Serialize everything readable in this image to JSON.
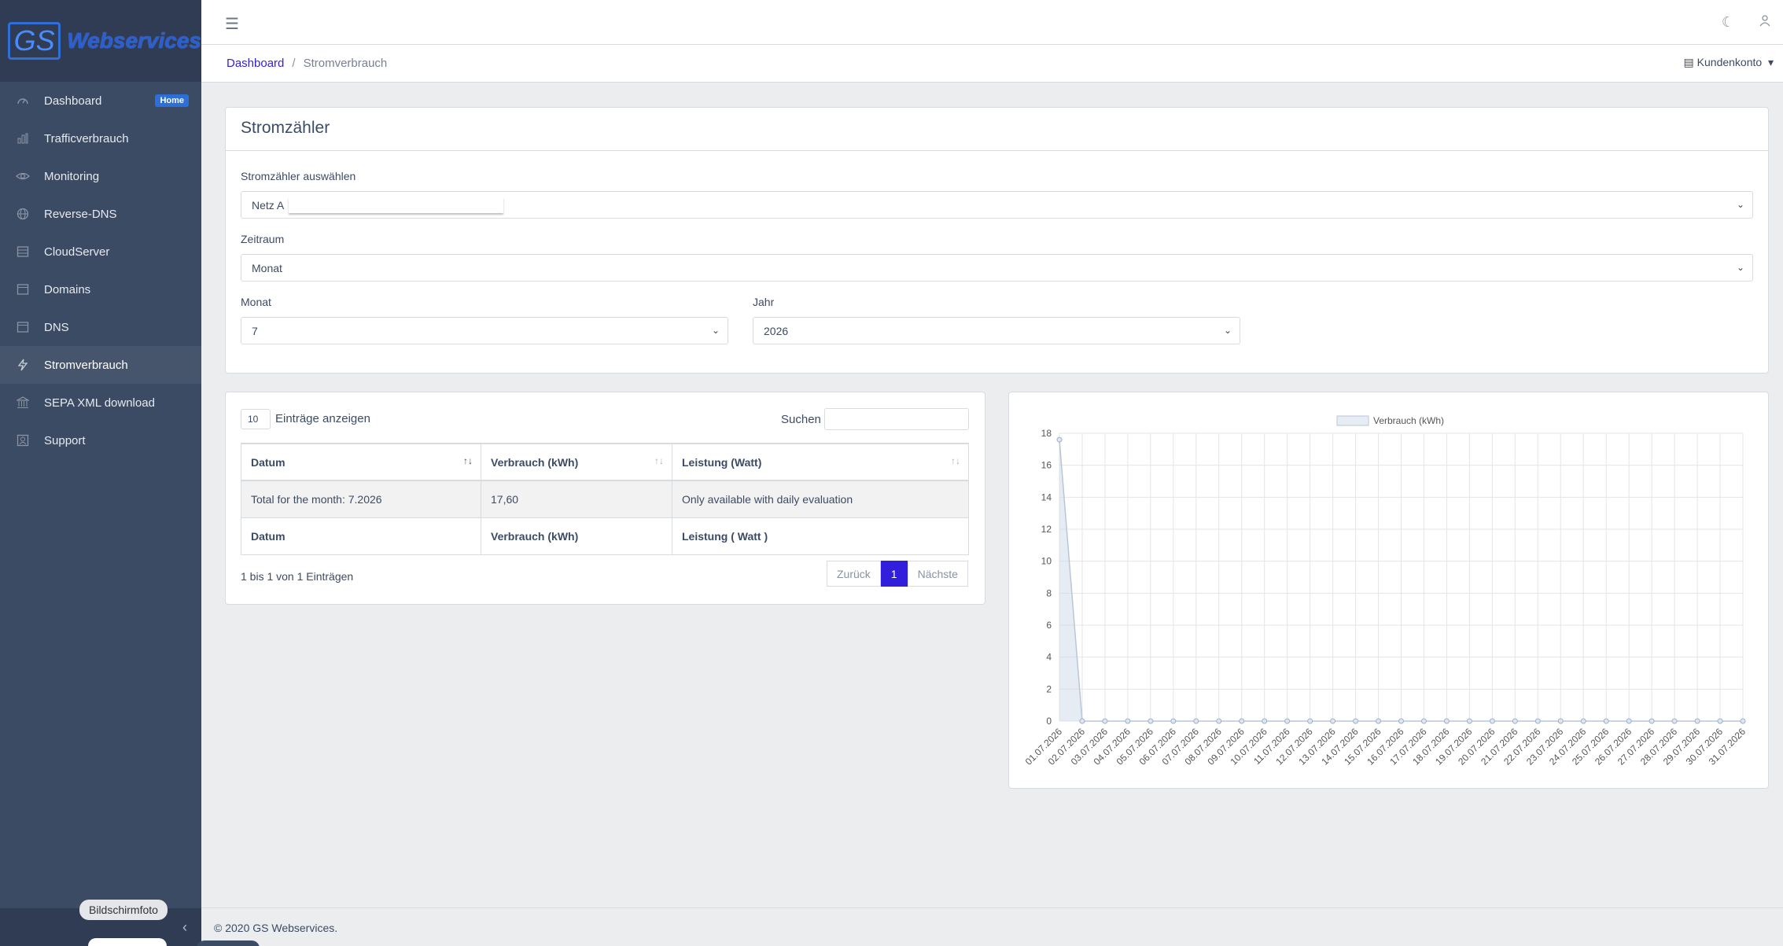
{
  "brand": {
    "logo": "GS",
    "name": "Webservices"
  },
  "sidebar": {
    "items": [
      {
        "label": "Dashboard",
        "icon": "speedometer-icon",
        "badge": "Home"
      },
      {
        "label": "Trafficverbrauch",
        "icon": "bar-chart-icon"
      },
      {
        "label": "Monitoring",
        "icon": "eye-icon"
      },
      {
        "label": "Reverse-DNS",
        "icon": "globe-icon"
      },
      {
        "label": "CloudServer",
        "icon": "server-icon"
      },
      {
        "label": "Domains",
        "icon": "browser-icon"
      },
      {
        "label": "DNS",
        "icon": "browser-icon"
      },
      {
        "label": "Stromverbrauch",
        "icon": "bolt-icon",
        "active": true
      },
      {
        "label": "SEPA XML download",
        "icon": "bank-icon"
      },
      {
        "label": "Support",
        "icon": "contact-icon"
      }
    ],
    "tooltip": "Bildschirmfoto"
  },
  "breadcrumb": {
    "root": "Dashboard",
    "current": "Stromverbrauch"
  },
  "account": {
    "label": "Kundenkonto"
  },
  "meter_card": {
    "title": "Stromzähler",
    "meter_label": "Stromzähler auswählen",
    "meter_value": "Netz A",
    "period_label": "Zeitraum",
    "period_value": "Monat",
    "month_label": "Monat",
    "month_value": "7",
    "year_label": "Jahr",
    "year_value": "2026"
  },
  "table_card": {
    "length_value": "10",
    "length_label": "Einträge anzeigen",
    "search_label": "Suchen",
    "columns": [
      "Datum",
      "Verbrauch (kWh)",
      "Leistung (Watt)"
    ],
    "rows": [
      [
        "Total for the month: 7.2026",
        "17,60",
        "Only available with daily evaluation"
      ]
    ],
    "footer_columns": [
      "Datum",
      "Verbrauch (kWh)",
      "Leistung ( Watt )"
    ],
    "info": "1 bis 1 von 1 Einträgen",
    "pager": {
      "prev": "Zurück",
      "page": "1",
      "next": "Nächste"
    }
  },
  "chart_data": {
    "type": "area",
    "legend": "Verbrauch (kWh)",
    "x": [
      "01.07.2026",
      "02.07.2026",
      "03.07.2026",
      "04.07.2026",
      "05.07.2026",
      "06.07.2026",
      "07.07.2026",
      "08.07.2026",
      "09.07.2026",
      "10.07.2026",
      "11.07.2026",
      "12.07.2026",
      "13.07.2026",
      "14.07.2026",
      "15.07.2026",
      "16.07.2026",
      "17.07.2026",
      "18.07.2026",
      "19.07.2026",
      "20.07.2026",
      "21.07.2026",
      "22.07.2026",
      "23.07.2026",
      "24.07.2026",
      "25.07.2026",
      "26.07.2026",
      "27.07.2026",
      "28.07.2026",
      "29.07.2026",
      "30.07.2026",
      "31.07.2026"
    ],
    "series": [
      {
        "name": "Verbrauch (kWh)",
        "values": [
          17.6,
          0,
          0,
          0,
          0,
          0,
          0,
          0,
          0,
          0,
          0,
          0,
          0,
          0,
          0,
          0,
          0,
          0,
          0,
          0,
          0,
          0,
          0,
          0,
          0,
          0,
          0,
          0,
          0,
          0,
          0
        ]
      }
    ],
    "yticks": [
      0,
      2,
      4,
      6,
      8,
      10,
      12,
      14,
      16,
      18
    ],
    "ylim": [
      0,
      18
    ],
    "grid": true,
    "legend_position": "top"
  },
  "footer": {
    "text": "© 2020 GS Webservices."
  }
}
